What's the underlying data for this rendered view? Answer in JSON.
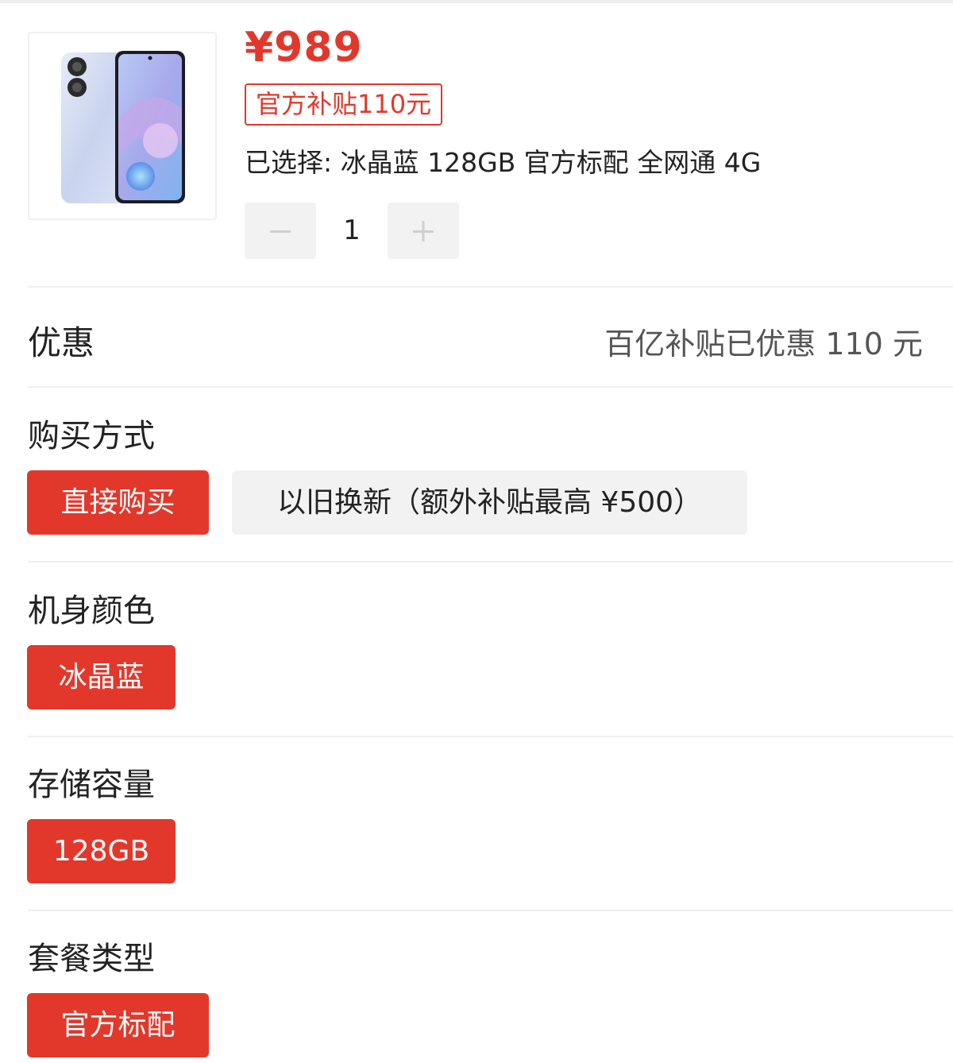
{
  "product": {
    "price": "¥989",
    "subsidy_tag": "官方补贴110元",
    "selected_summary": "已选择: 冰晶蓝 128GB 官方标配 全网通 4G",
    "quantity": "1"
  },
  "promotion": {
    "label": "优惠",
    "value": "百亿补贴已优惠 110 元"
  },
  "purchase_method": {
    "title": "购买方式",
    "options": [
      "直接购买",
      "以旧换新（额外补贴最高 ¥500）"
    ],
    "selected_index": 0
  },
  "color": {
    "title": "机身颜色",
    "options": [
      "冰晶蓝"
    ],
    "selected_index": 0
  },
  "storage": {
    "title": "存储容量",
    "options": [
      "128GB"
    ],
    "selected_index": 0
  },
  "package": {
    "title": "套餐类型",
    "options": [
      "官方标配"
    ],
    "selected_index": 0
  },
  "colors": {
    "accent": "#e2382b",
    "chip_inactive_bg": "#f2f2f2",
    "divider": "#efefef"
  },
  "icons": {
    "minus": "minus-icon",
    "plus": "plus-icon"
  }
}
